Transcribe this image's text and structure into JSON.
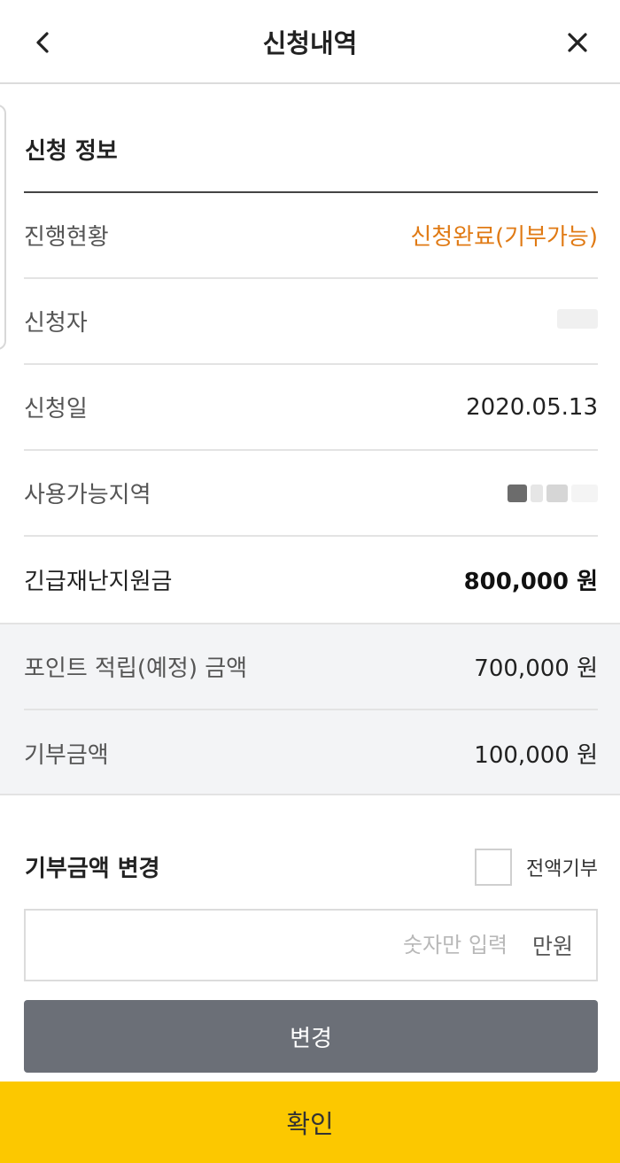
{
  "header": {
    "title": "신청내역",
    "back_icon": "chevron-left-icon",
    "close_icon": "close-icon"
  },
  "info": {
    "section_title": "신청 정보",
    "rows": [
      {
        "label": "진행현황",
        "value": "신청완료(기부가능)"
      },
      {
        "label": "신청자",
        "value": ""
      },
      {
        "label": "신청일",
        "value": "2020.05.13"
      },
      {
        "label": "사용가능지역",
        "value": ""
      },
      {
        "label": "긴급재난지원금",
        "value": "800,000 원"
      }
    ]
  },
  "summary": {
    "rows": [
      {
        "label": "포인트 적립(예정) 금액",
        "value": "700,000 원"
      },
      {
        "label": "기부금액",
        "value": "100,000 원"
      }
    ]
  },
  "change": {
    "title": "기부금액 변경",
    "checkbox_label": "전액기부",
    "input_placeholder": "숫자만 입력",
    "input_value": "",
    "unit": "만원",
    "change_button": "변경"
  },
  "footer": {
    "confirm_button": "확인"
  },
  "colors": {
    "accent_yellow": "#fcc800",
    "status_orange": "#e07a14",
    "button_grey": "#6b6f77",
    "band_grey": "#f3f4f6"
  }
}
